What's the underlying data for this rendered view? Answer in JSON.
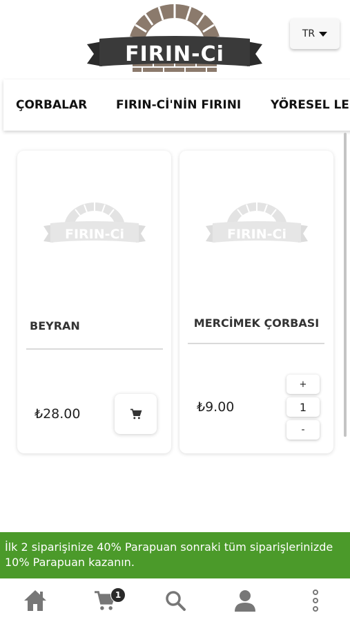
{
  "header": {
    "logo_text": "FIRIN-Ci",
    "language": "TR"
  },
  "categories": [
    {
      "label": "ÇORBALAR"
    },
    {
      "label": "FIRIN-Cİ'NİN FIRINI"
    },
    {
      "label": "YÖRESEL LE"
    }
  ],
  "products": [
    {
      "name": "BEYRAN",
      "price": "₺28.00",
      "placeholder_logo": "FIRIN-Ci",
      "action_icon": "cart-icon"
    },
    {
      "name": "MERCİMEK ÇORBASI",
      "price": "₺9.00",
      "placeholder_logo": "FIRIN-Ci",
      "qty_plus": "+",
      "quantity": "1",
      "qty_minus": "-"
    }
  ],
  "promo": {
    "text": "İlk 2 siparişinize 40% Parapuan sonraki tüm siparişlerinizde 10% Parapuan kazanın."
  },
  "bottom_nav": {
    "items": [
      "home-icon",
      "cart-icon",
      "search-icon",
      "user-icon",
      "more-icon"
    ],
    "cart_badge": "1"
  },
  "colors": {
    "promo_bg": "#4b9a2a",
    "logo_banner": "#3a3a3a",
    "logo_bricks": "#8b7a6c",
    "nav_icon": "#777777"
  }
}
